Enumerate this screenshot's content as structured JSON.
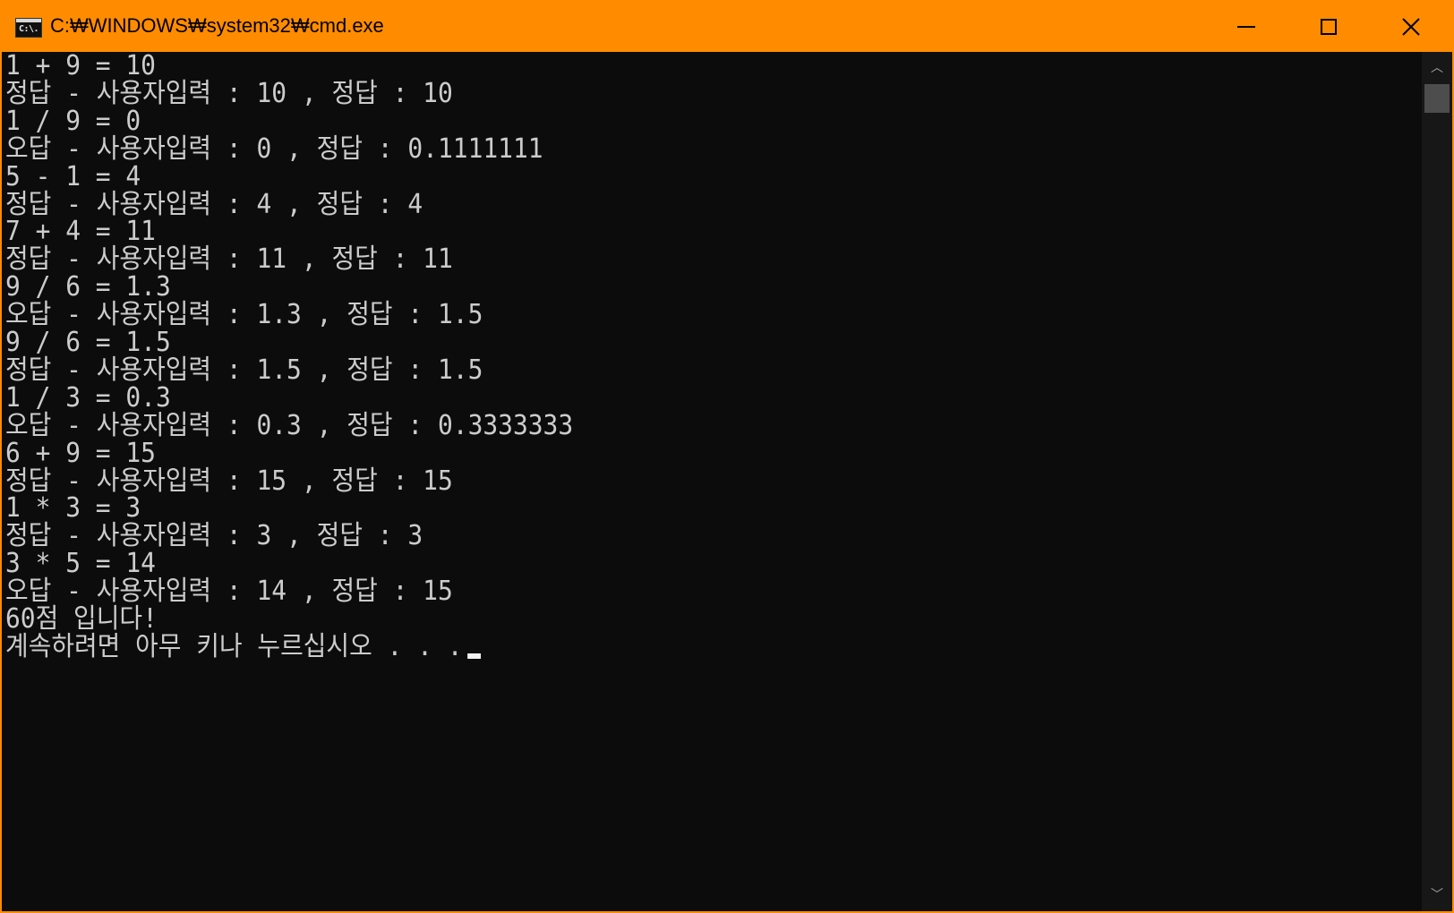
{
  "window": {
    "title": "C:₩WINDOWS₩system32₩cmd.exe",
    "icon_label": "C:\\."
  },
  "controls": {
    "minimize_icon": "minimize-icon",
    "maximize_icon": "maximize-icon",
    "close_icon": "close-icon",
    "close_glyph": "✕"
  },
  "colors": {
    "titlebar": "#ff8c00",
    "console_bg": "#0c0c0c",
    "console_text": "#cccccc"
  },
  "console": {
    "lines": [
      "1 + 9 = 10",
      "정답 - 사용자입력 : 10 , 정답 : 10",
      "1 / 9 = 0",
      "오답 - 사용자입력 : 0 , 정답 : 0.1111111",
      "5 - 1 = 4",
      "정답 - 사용자입력 : 4 , 정답 : 4",
      "7 + 4 = 11",
      "정답 - 사용자입력 : 11 , 정답 : 11",
      "9 / 6 = 1.3",
      "오답 - 사용자입력 : 1.3 , 정답 : 1.5",
      "9 / 6 = 1.5",
      "정답 - 사용자입력 : 1.5 , 정답 : 1.5",
      "1 / 3 = 0.3",
      "오답 - 사용자입력 : 0.3 , 정답 : 0.3333333",
      "6 + 9 = 15",
      "정답 - 사용자입력 : 15 , 정답 : 15",
      "1 * 3 = 3",
      "정답 - 사용자입력 : 3 , 정답 : 3",
      "3 * 5 = 14",
      "오답 - 사용자입력 : 14 , 정답 : 15",
      "60점 입니다!",
      "계속하려면 아무 키나 누르십시오 . . ."
    ]
  },
  "scrollbar": {
    "up_glyph": "︿",
    "down_glyph": "﹀"
  }
}
